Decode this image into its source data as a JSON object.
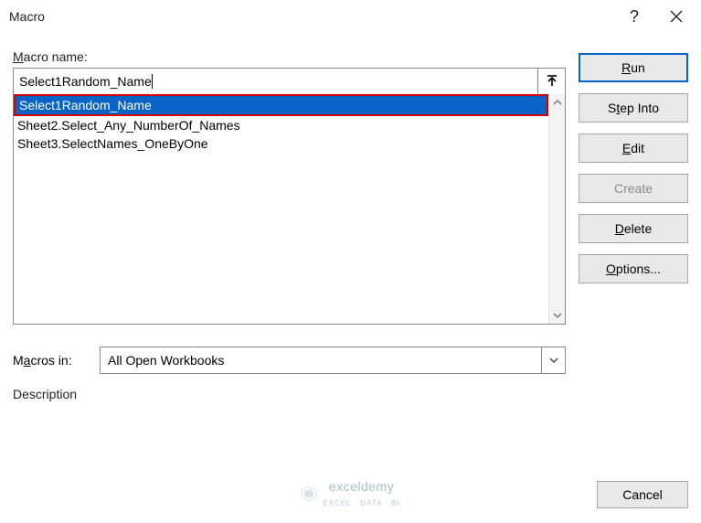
{
  "title": "Macro",
  "labels": {
    "macro_name": "Macro name:",
    "macros_in": "Macros in:",
    "description": "Description"
  },
  "macro_name_input": "Select1Random_Name",
  "macro_list": [
    {
      "label": "Select1Random_Name",
      "selected": true
    },
    {
      "label": "Sheet2.Select_Any_NumberOf_Names",
      "selected": false
    },
    {
      "label": "Sheet3.SelectNames_OneByOne",
      "selected": false
    }
  ],
  "macros_in_value": "All Open Workbooks",
  "buttons": {
    "run": "Run",
    "step_into_pre": "S",
    "step_into_u": "t",
    "step_into_post": "ep Into",
    "edit_u": "E",
    "edit_post": "dit",
    "create": "Create",
    "delete_u": "D",
    "delete_post": "elete",
    "options_u": "O",
    "options_post": "ptions...",
    "cancel": "Cancel"
  },
  "watermark": {
    "brand": "exceldemy",
    "tagline": "EXCEL · DATA · BI"
  }
}
